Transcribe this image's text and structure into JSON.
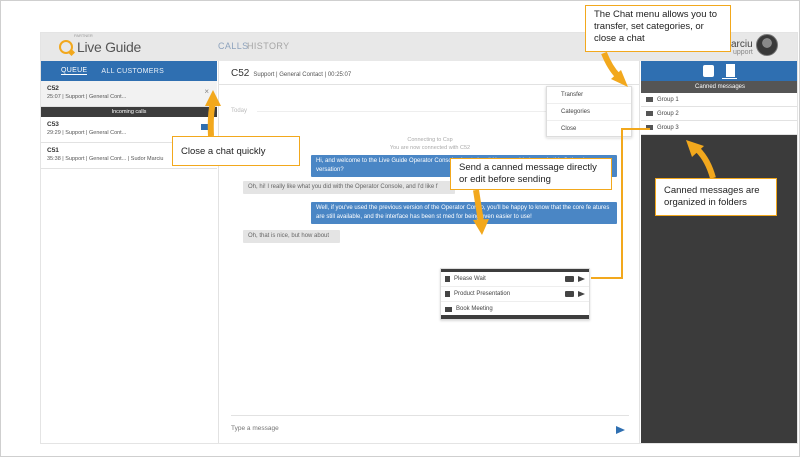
{
  "brand": {
    "name": "Live Guide",
    "sub": "PARTNER"
  },
  "nav": {
    "calls": "CALLS",
    "history": "HISTORY"
  },
  "user": {
    "name": "arciu",
    "role": "upport"
  },
  "left_tabs": {
    "queue": "QUEUE",
    "all_customers": "ALL CUSTOMERS"
  },
  "chats": [
    {
      "id": "C52",
      "meta": "25:07 | Support | General Cont..."
    },
    {
      "id": "C53",
      "meta": "29:29 | Support | General Cont..."
    },
    {
      "id": "C51",
      "meta": "35:38 | Support | General Cont... | Sudor Marciu"
    }
  ],
  "incoming_label": "Incoming calls",
  "chat_header": {
    "id": "C52",
    "info": "Support | General Contact | 00:25:07"
  },
  "day_label": "Today",
  "system": {
    "line1": "Connecting to Csp",
    "line2": "You are now connected with C52"
  },
  "messages": [
    {
      "text": "Hi, and welcome to the Live Guide Operator Console cheat sheet! How may I help you in this fictional con versation?"
    },
    {
      "text": "Oh, hi! I really like what you did with the Operator Console, and I'd like f"
    },
    {
      "text": "Well, if you've used the previous version of the Operator Conso, you'll be happy to know that the core fe atures are still available, and the interface has been st med for being even easier to use!"
    },
    {
      "text": "Oh, that is nice, but how about"
    }
  ],
  "canned_popup": [
    {
      "name": "Please Wait"
    },
    {
      "name": "Product Presentation"
    },
    {
      "name": "Book Meeting"
    }
  ],
  "composer": {
    "placeholder": "Type a message"
  },
  "chat_menu": [
    "Transfer",
    "Categories",
    "Close"
  ],
  "canned": {
    "title": "Canned messages",
    "groups": [
      "Group 1",
      "Group 2",
      "Group 3"
    ]
  },
  "callouts": {
    "close": "Close a chat quickly",
    "chat_menu": "The Chat menu allows you to transfer, set categories, or close a chat",
    "send": "Send a canned message directly or edit before sending",
    "folders": "Canned messages are organized in folders"
  },
  "colors": {
    "accent": "#2f6fb1",
    "callout_border": "#f2a81d",
    "panel_dark": "#3b3b3b"
  }
}
